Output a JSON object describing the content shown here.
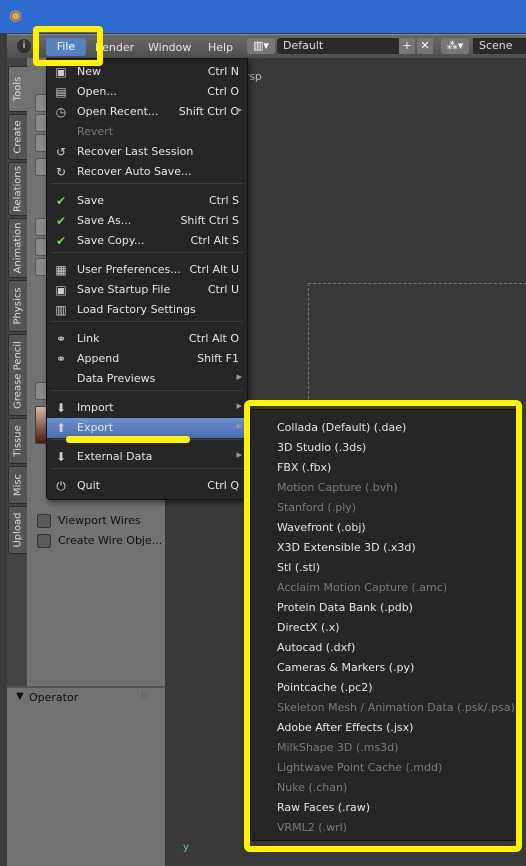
{
  "menubar": {
    "items": [
      "File",
      "Render",
      "Window",
      "Help"
    ],
    "layout": "Default",
    "scene": "Scene"
  },
  "tabs": [
    "Tools",
    "Create",
    "Relations",
    "Animation",
    "Physics",
    "Grease Pencil",
    "Tissue",
    "Misc",
    "Upload"
  ],
  "viewport": {
    "label_partial": "Camera Persp"
  },
  "tool_shelf": {
    "options": [
      "Viewport Wires",
      "Create Wire Obje..."
    ],
    "operator_label": "Operator"
  },
  "file_menu": {
    "items": [
      {
        "label": "New",
        "shortcut": "Ctrl N",
        "icon": "new-file-icon",
        "glyph": "▣"
      },
      {
        "label": "Open...",
        "shortcut": "Ctrl O",
        "icon": "open-folder-icon",
        "glyph": "▤"
      },
      {
        "label": "Open Recent...",
        "shortcut": "Shift Ctrl O",
        "icon": "recent-icon",
        "glyph": "◷",
        "submenu": true
      },
      {
        "label": "Revert",
        "shortcut": "",
        "icon": "",
        "glyph": "",
        "disabled": true
      },
      {
        "label": "Recover Last Session",
        "shortcut": "",
        "icon": "recover-icon",
        "glyph": "↺"
      },
      {
        "label": "Recover Auto Save...",
        "shortcut": "",
        "icon": "recover-auto-icon",
        "glyph": "↻"
      },
      {
        "label": "Save",
        "shortcut": "Ctrl S",
        "icon": "check-icon",
        "glyph": "✔"
      },
      {
        "label": "Save As...",
        "shortcut": "Shift Ctrl S",
        "icon": "check-icon",
        "glyph": "✔"
      },
      {
        "label": "Save Copy...",
        "shortcut": "Ctrl Alt S",
        "icon": "check-icon",
        "glyph": "✔"
      },
      {
        "label": "User Preferences...",
        "shortcut": "Ctrl Alt U",
        "icon": "preferences-icon",
        "glyph": "▦"
      },
      {
        "label": "Save Startup File",
        "shortcut": "Ctrl U",
        "icon": "save-startup-icon",
        "glyph": "▣"
      },
      {
        "label": "Load Factory Settings",
        "shortcut": "",
        "icon": "factory-settings-icon",
        "glyph": "▥"
      },
      {
        "label": "Link",
        "shortcut": "Ctrl Alt O",
        "icon": "link-icon",
        "glyph": "⚭"
      },
      {
        "label": "Append",
        "shortcut": "Shift F1",
        "icon": "append-icon",
        "glyph": "⚭"
      },
      {
        "label": "Data Previews",
        "shortcut": "",
        "icon": "",
        "glyph": "",
        "submenu": true
      },
      {
        "label": "Import",
        "shortcut": "",
        "icon": "import-icon",
        "glyph": "⬇",
        "submenu": true
      },
      {
        "label": "Export",
        "shortcut": "",
        "icon": "export-icon",
        "glyph": "⬆",
        "submenu": true,
        "active": true
      },
      {
        "label": "External Data",
        "shortcut": "",
        "icon": "external-data-icon",
        "glyph": "⬇",
        "submenu": true
      },
      {
        "label": "Quit",
        "shortcut": "Ctrl Q",
        "icon": "quit-icon",
        "glyph": "⏻"
      }
    ]
  },
  "export_menu": {
    "items": [
      {
        "label": "Collada (Default) (.dae)",
        "disabled": false
      },
      {
        "label": "3D Studio (.3ds)",
        "disabled": false
      },
      {
        "label": "FBX (.fbx)",
        "disabled": false
      },
      {
        "label": "Motion Capture (.bvh)",
        "disabled": true
      },
      {
        "label": "Stanford (.ply)",
        "disabled": true
      },
      {
        "label": "Wavefront (.obj)",
        "disabled": false
      },
      {
        "label": "X3D Extensible 3D (.x3d)",
        "disabled": false
      },
      {
        "label": "Stl (.stl)",
        "disabled": false
      },
      {
        "label": "Acclaim Motion Capture (.amc)",
        "disabled": true
      },
      {
        "label": "Protein Data Bank (.pdb)",
        "disabled": false
      },
      {
        "label": "DirectX (.x)",
        "disabled": false
      },
      {
        "label": "Autocad (.dxf)",
        "disabled": false
      },
      {
        "label": "Cameras & Markers (.py)",
        "disabled": false
      },
      {
        "label": "Pointcache (.pc2)",
        "disabled": false
      },
      {
        "label": "Skeleton Mesh / Animation Data (.psk/.psa)",
        "disabled": true
      },
      {
        "label": "Adobe After Effects (.jsx)",
        "disabled": false
      },
      {
        "label": "MilkShape 3D (.ms3d)",
        "disabled": true
      },
      {
        "label": "Lightwave Point Cache (.mdd)",
        "disabled": true
      },
      {
        "label": "Nuke (.chan)",
        "disabled": true
      },
      {
        "label": "Raw Faces (.raw)",
        "disabled": false
      },
      {
        "label": "VRML2 (.wrl)",
        "disabled": true
      }
    ]
  },
  "colors": {
    "highlight": "#fff200",
    "menu_bg": "#262626",
    "active_item": "#5680c2"
  }
}
